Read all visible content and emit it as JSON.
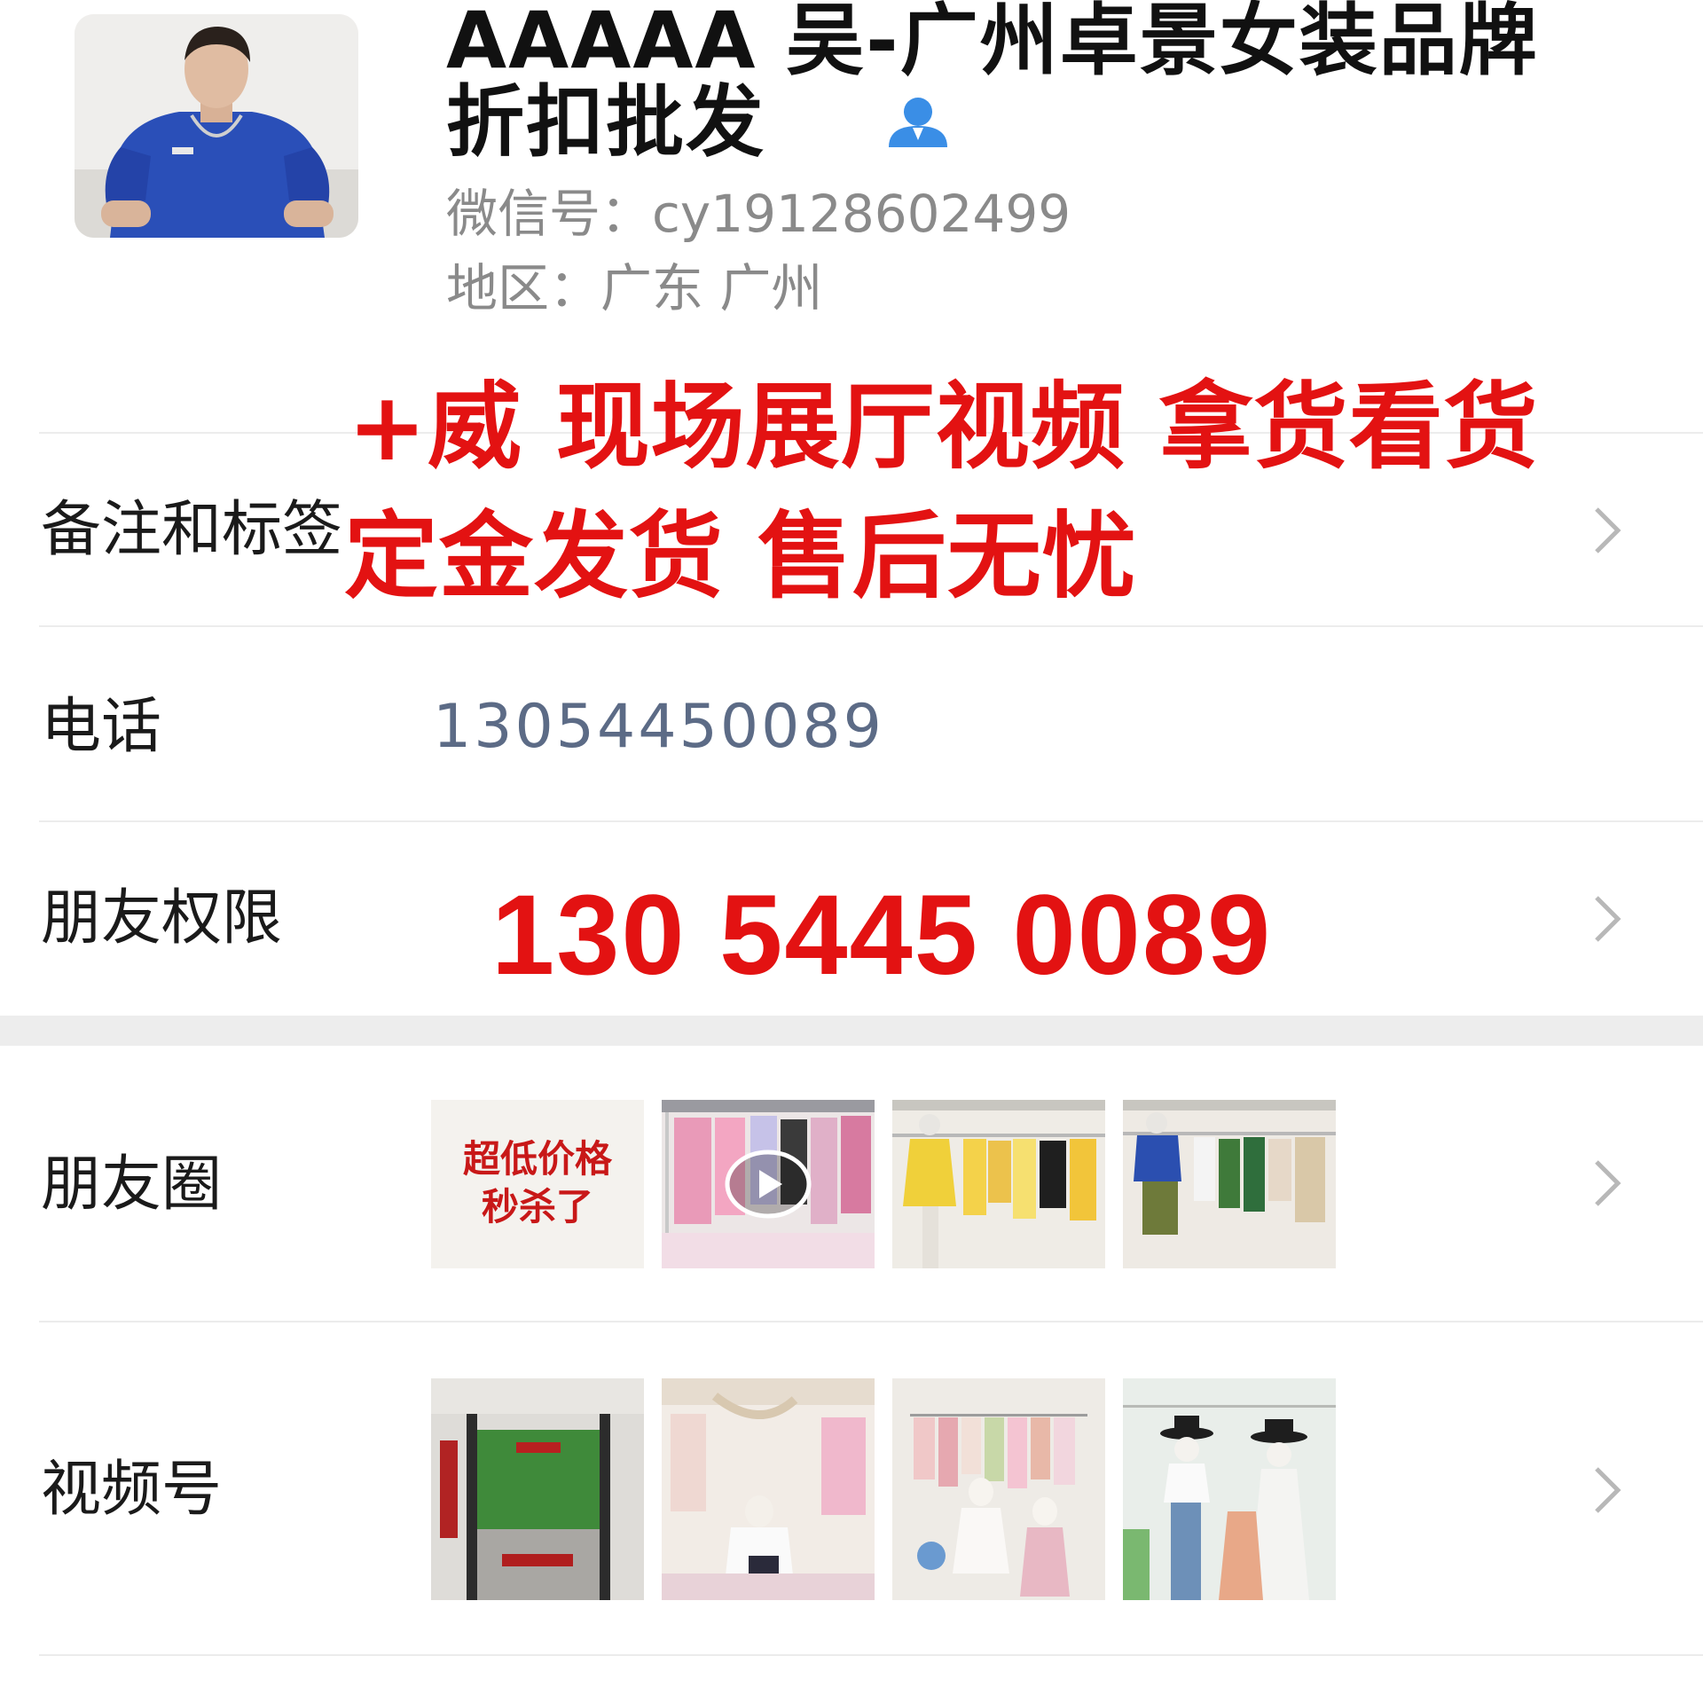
{
  "profile": {
    "nickname_line1": "AAAAA 吴-广州卓景女装品牌",
    "nickname_line2": "折扣批发",
    "wechat_id": "微信号：cy19128602499",
    "region": "地区：广东 广州",
    "contact_icon": "person-icon"
  },
  "rows": {
    "remarks_label": "备注和标签",
    "phone_label": "电话",
    "phone_value": "13054450089",
    "permissions_label": "朋友权限",
    "moments_label": "朋友圈",
    "channels_label": "视频号"
  },
  "overlay": {
    "promo_line1": "+威 现场展厅视频 拿货看货",
    "promo_line2": "定金发货 售后无忧",
    "promo_phone": "130 5445 0089"
  },
  "moments": {
    "sale_line1": "超低价格",
    "sale_line2": "秒杀了"
  },
  "colors": {
    "promo_red": "#e31212",
    "phone_link": "#5c6b86",
    "secondary_text": "#8a8a8a",
    "contact_icon_blue": "#3a8ee6"
  },
  "icons": [
    "person-icon",
    "chevron-right-icon",
    "play-icon"
  ]
}
